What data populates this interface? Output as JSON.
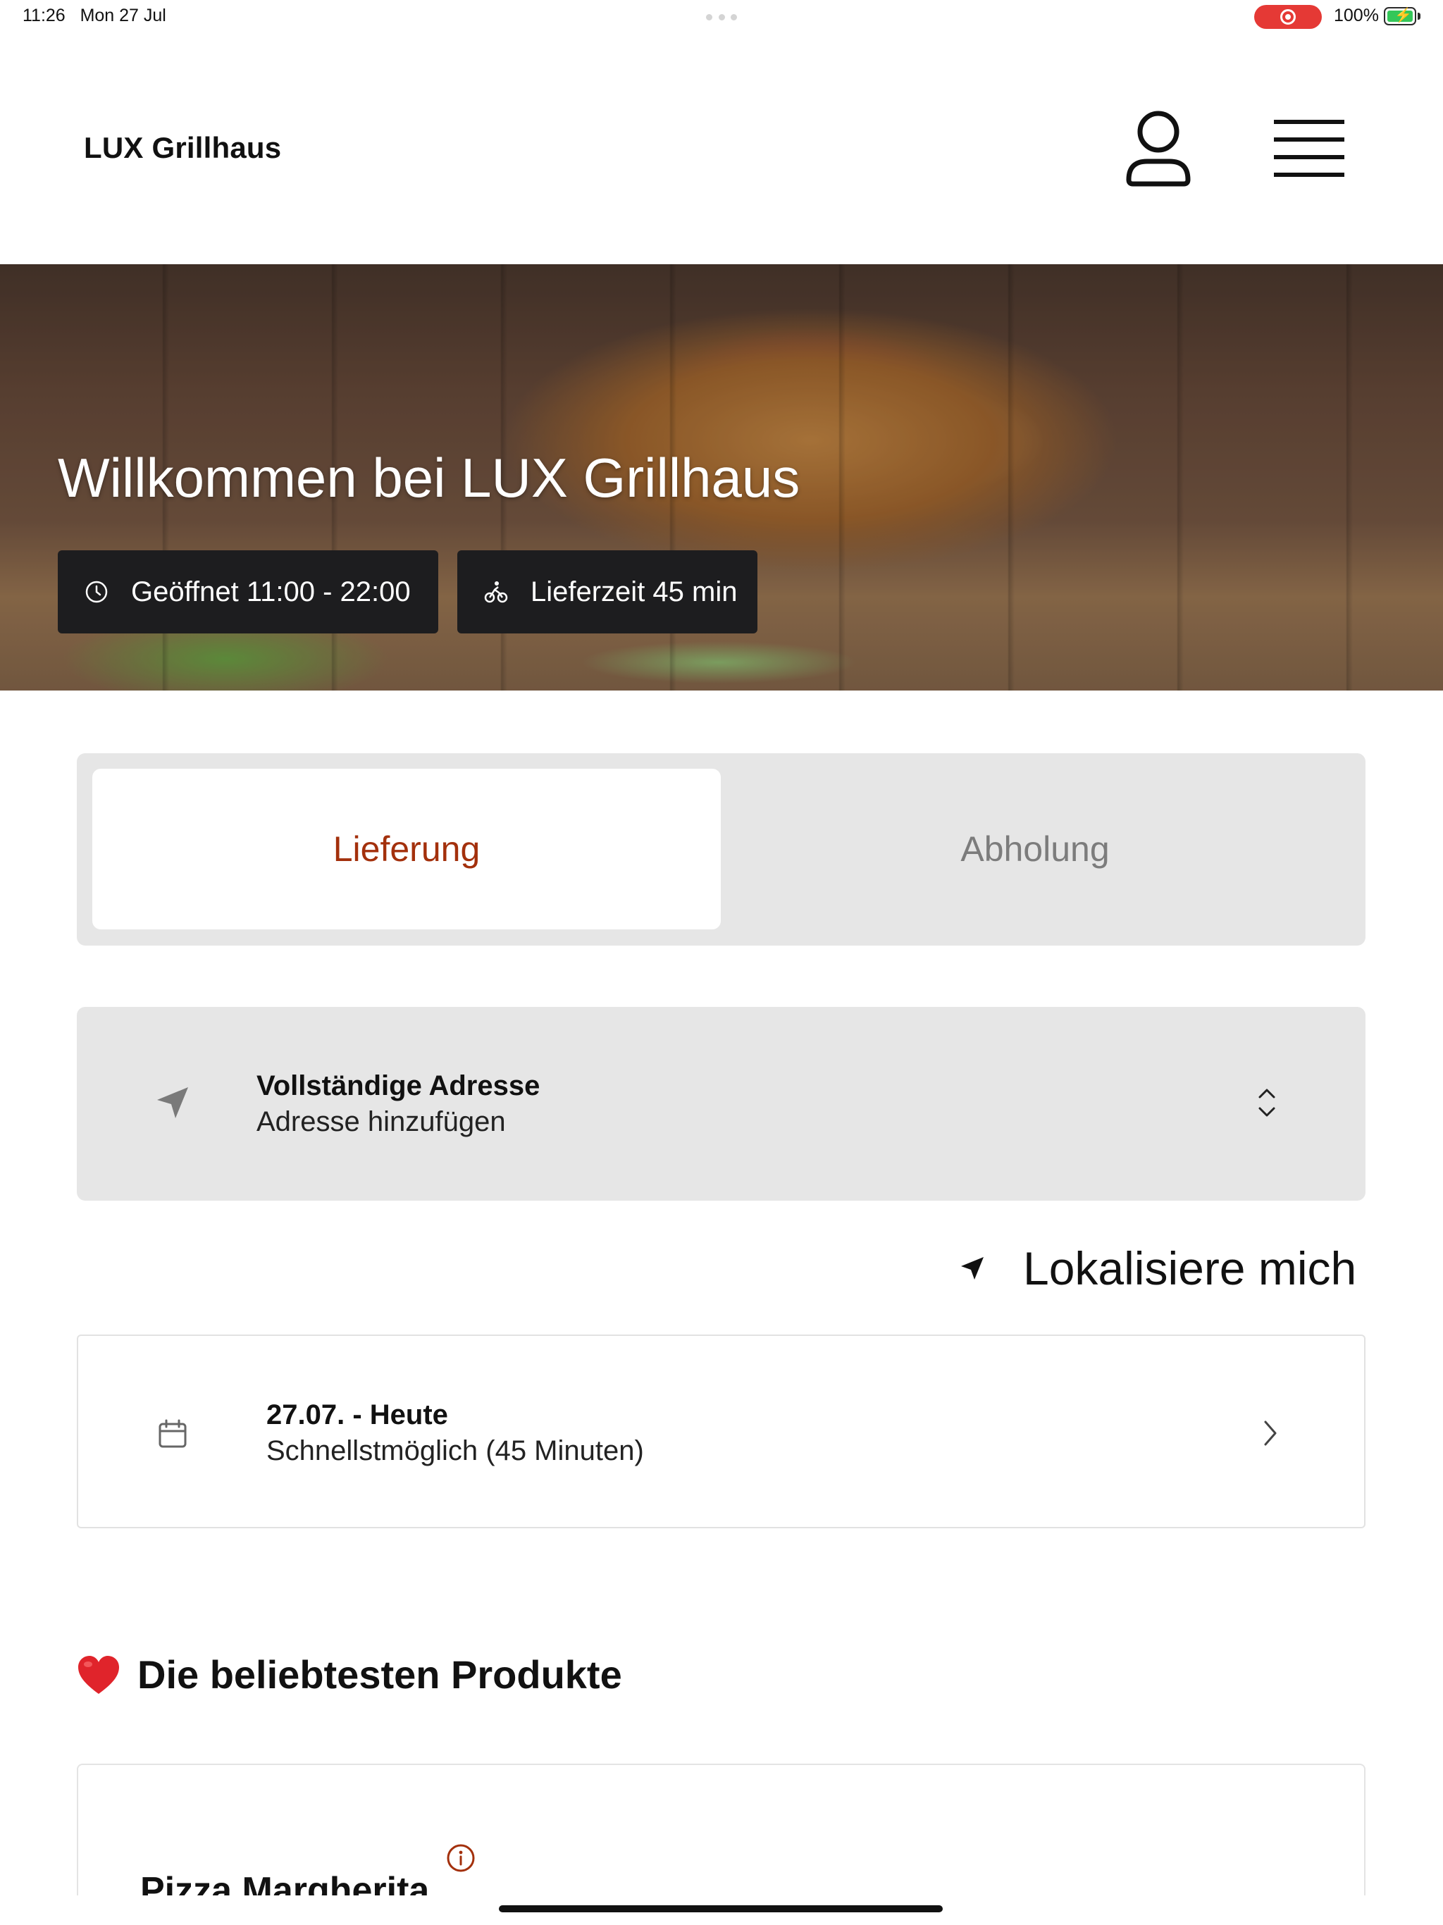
{
  "status_bar": {
    "time": "11:26",
    "date": "Mon 27 Jul",
    "battery_percent": "100%",
    "recording_color": "#e53935",
    "battery_color": "#34c759"
  },
  "header": {
    "brand": "LUX Grillhaus",
    "icons": [
      "user-icon",
      "menu-icon"
    ]
  },
  "hero": {
    "title": "Willkommen bei LUX Grillhaus",
    "opening_hours": "Geöffnet 11:00 - 22:00",
    "delivery_time": "Lieferzeit 45 min",
    "icons": [
      "clock-icon",
      "bike-icon"
    ]
  },
  "order_mode": {
    "delivery_label": "Lieferung",
    "pickup_label": "Abholung",
    "selected": "Lieferung",
    "accent_color": "#a3300c"
  },
  "address": {
    "title": "Vollständige Adresse",
    "subtitle": "Adresse hinzufügen",
    "icons": [
      "location-arrow-icon",
      "chevron-up-down-icon"
    ]
  },
  "locate": {
    "label": "Lokalisiere mich"
  },
  "schedule": {
    "title": "27.07. - Heute",
    "subtitle": "Schnellstmöglich (45 Minuten)",
    "icons": [
      "calendar-icon",
      "chevron-right-icon"
    ]
  },
  "popular": {
    "title": "Die beliebtesten Produkte",
    "products": [
      {
        "name": "Pizza Margherita"
      }
    ]
  }
}
